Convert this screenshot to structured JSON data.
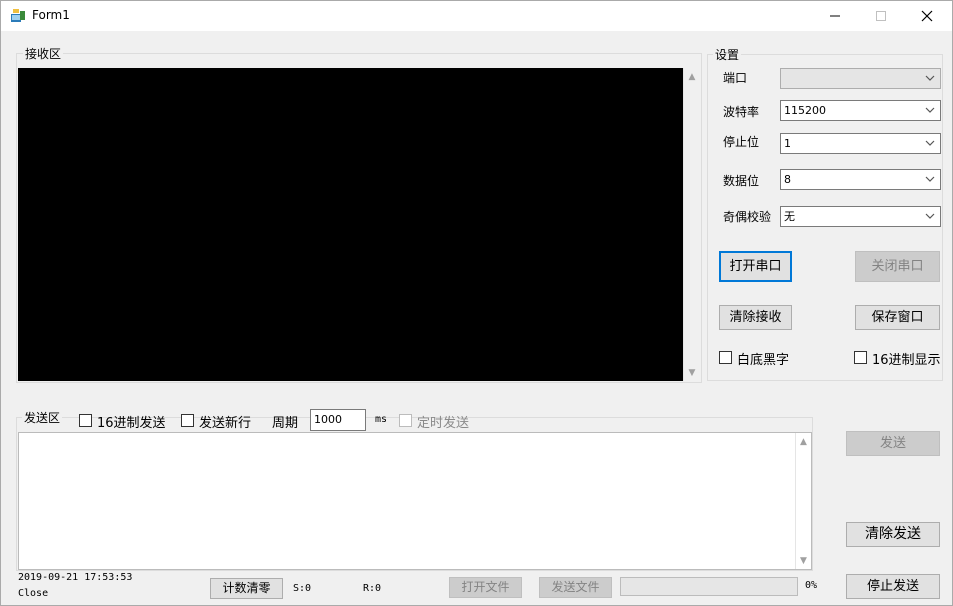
{
  "window": {
    "title": "Form1"
  },
  "receive": {
    "label": "接收区"
  },
  "settings": {
    "label": "设置",
    "port": {
      "label": "端口",
      "value": ""
    },
    "baud": {
      "label": "波特率",
      "value": "115200"
    },
    "stopbits": {
      "label": "停止位",
      "value": "1"
    },
    "databits": {
      "label": "数据位",
      "value": "8"
    },
    "parity": {
      "label": "奇偶校验",
      "value": "无"
    },
    "open_btn": "打开串口",
    "close_btn": "关闭串口",
    "clear_recv_btn": "清除接收",
    "save_btn": "保存窗口",
    "white_bg_label": "白底黑字",
    "hex_display_label": "16进制显示"
  },
  "send": {
    "label": "发送区",
    "hex_send_label": "16进制发送",
    "newline_label": "发送新行",
    "period_label": "周期",
    "period_value": "1000",
    "ms_label": "ms",
    "timed_label": "定时发送",
    "send_btn": "发送",
    "clear_send_btn": "清除发送",
    "stop_send_btn": "停止发送"
  },
  "status": {
    "datetime": "2019-09-21 17:53:53",
    "state": "Close",
    "reset_count_btn": "计数清零",
    "s_count": "S:0",
    "r_count": "R:0",
    "open_file_btn": "打开文件",
    "send_file_btn": "发送文件",
    "progress_percent": "0%",
    "progress_value": 0
  }
}
